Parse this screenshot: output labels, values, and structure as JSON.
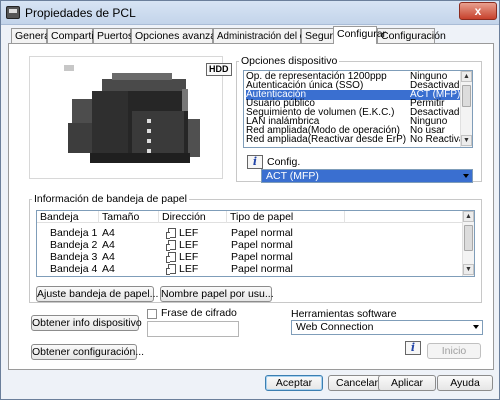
{
  "window": {
    "title": "Propiedades de PCL",
    "close_label": "x"
  },
  "tabs": [
    {
      "label": "General"
    },
    {
      "label": "Compartir"
    },
    {
      "label": "Puertos"
    },
    {
      "label": "Opciones avanzadas"
    },
    {
      "label": "Administración del color"
    },
    {
      "label": "Seguridad"
    },
    {
      "label": "Configurar"
    },
    {
      "label": "Configuración"
    }
  ],
  "active_tab": "Configurar",
  "printer": {
    "hdd_badge": "HDD"
  },
  "options": {
    "title": "Opciones dispositivo",
    "rows": [
      {
        "name": "Op. de representación 1200ppp",
        "value": "Ninguno"
      },
      {
        "name": "Autenticación única (SSO)",
        "value": "Desactivado"
      },
      {
        "name": "Autenticación",
        "value": "ACT (MFP)",
        "selected": true
      },
      {
        "name": "Usuario público",
        "value": "Permitir"
      },
      {
        "name": "Seguimiento de volumen (E.K.C.)",
        "value": "Desactivado"
      },
      {
        "name": "LAN inalámbrica",
        "value": "Ninguno"
      },
      {
        "name": "Red ampliada(Modo de operación)",
        "value": "No usar"
      },
      {
        "name": "Red ampliada(Reactivar desde ErP)",
        "value": "No Reactivar"
      }
    ],
    "config_label": "Config.",
    "config_value": "ACT (MFP)"
  },
  "tray_info": {
    "title": "Información de bandeja de papel",
    "headers": [
      "Bandeja",
      "Tamaño",
      "Dirección",
      "Tipo de papel"
    ],
    "rows": [
      {
        "tray": "Bandeja 1",
        "size": "A4",
        "direction": "LEF",
        "type": "Papel normal"
      },
      {
        "tray": "Bandeja 2",
        "size": "A4",
        "direction": "LEF",
        "type": "Papel normal"
      },
      {
        "tray": "Bandeja 3",
        "size": "A4",
        "direction": "LEF",
        "type": "Papel normal"
      },
      {
        "tray": "Bandeja 4",
        "size": "A4",
        "direction": "LEF",
        "type": "Papel normal"
      }
    ],
    "adjust_button": "Ajuste bandeja de papel...",
    "name_button": "Nombre papel por usu..."
  },
  "device_info_button": "Obtener info dispositivo",
  "passphrase_label": "Frase de cifrado",
  "software_tools": {
    "label": "Herramientas software",
    "value": "Web Connection",
    "start_button": "Inicio"
  },
  "get_config_button": "Obtener configuración...",
  "footer": {
    "ok": "Aceptar",
    "cancel": "Cancelar",
    "apply": "Aplicar",
    "help": "Ayuda"
  }
}
